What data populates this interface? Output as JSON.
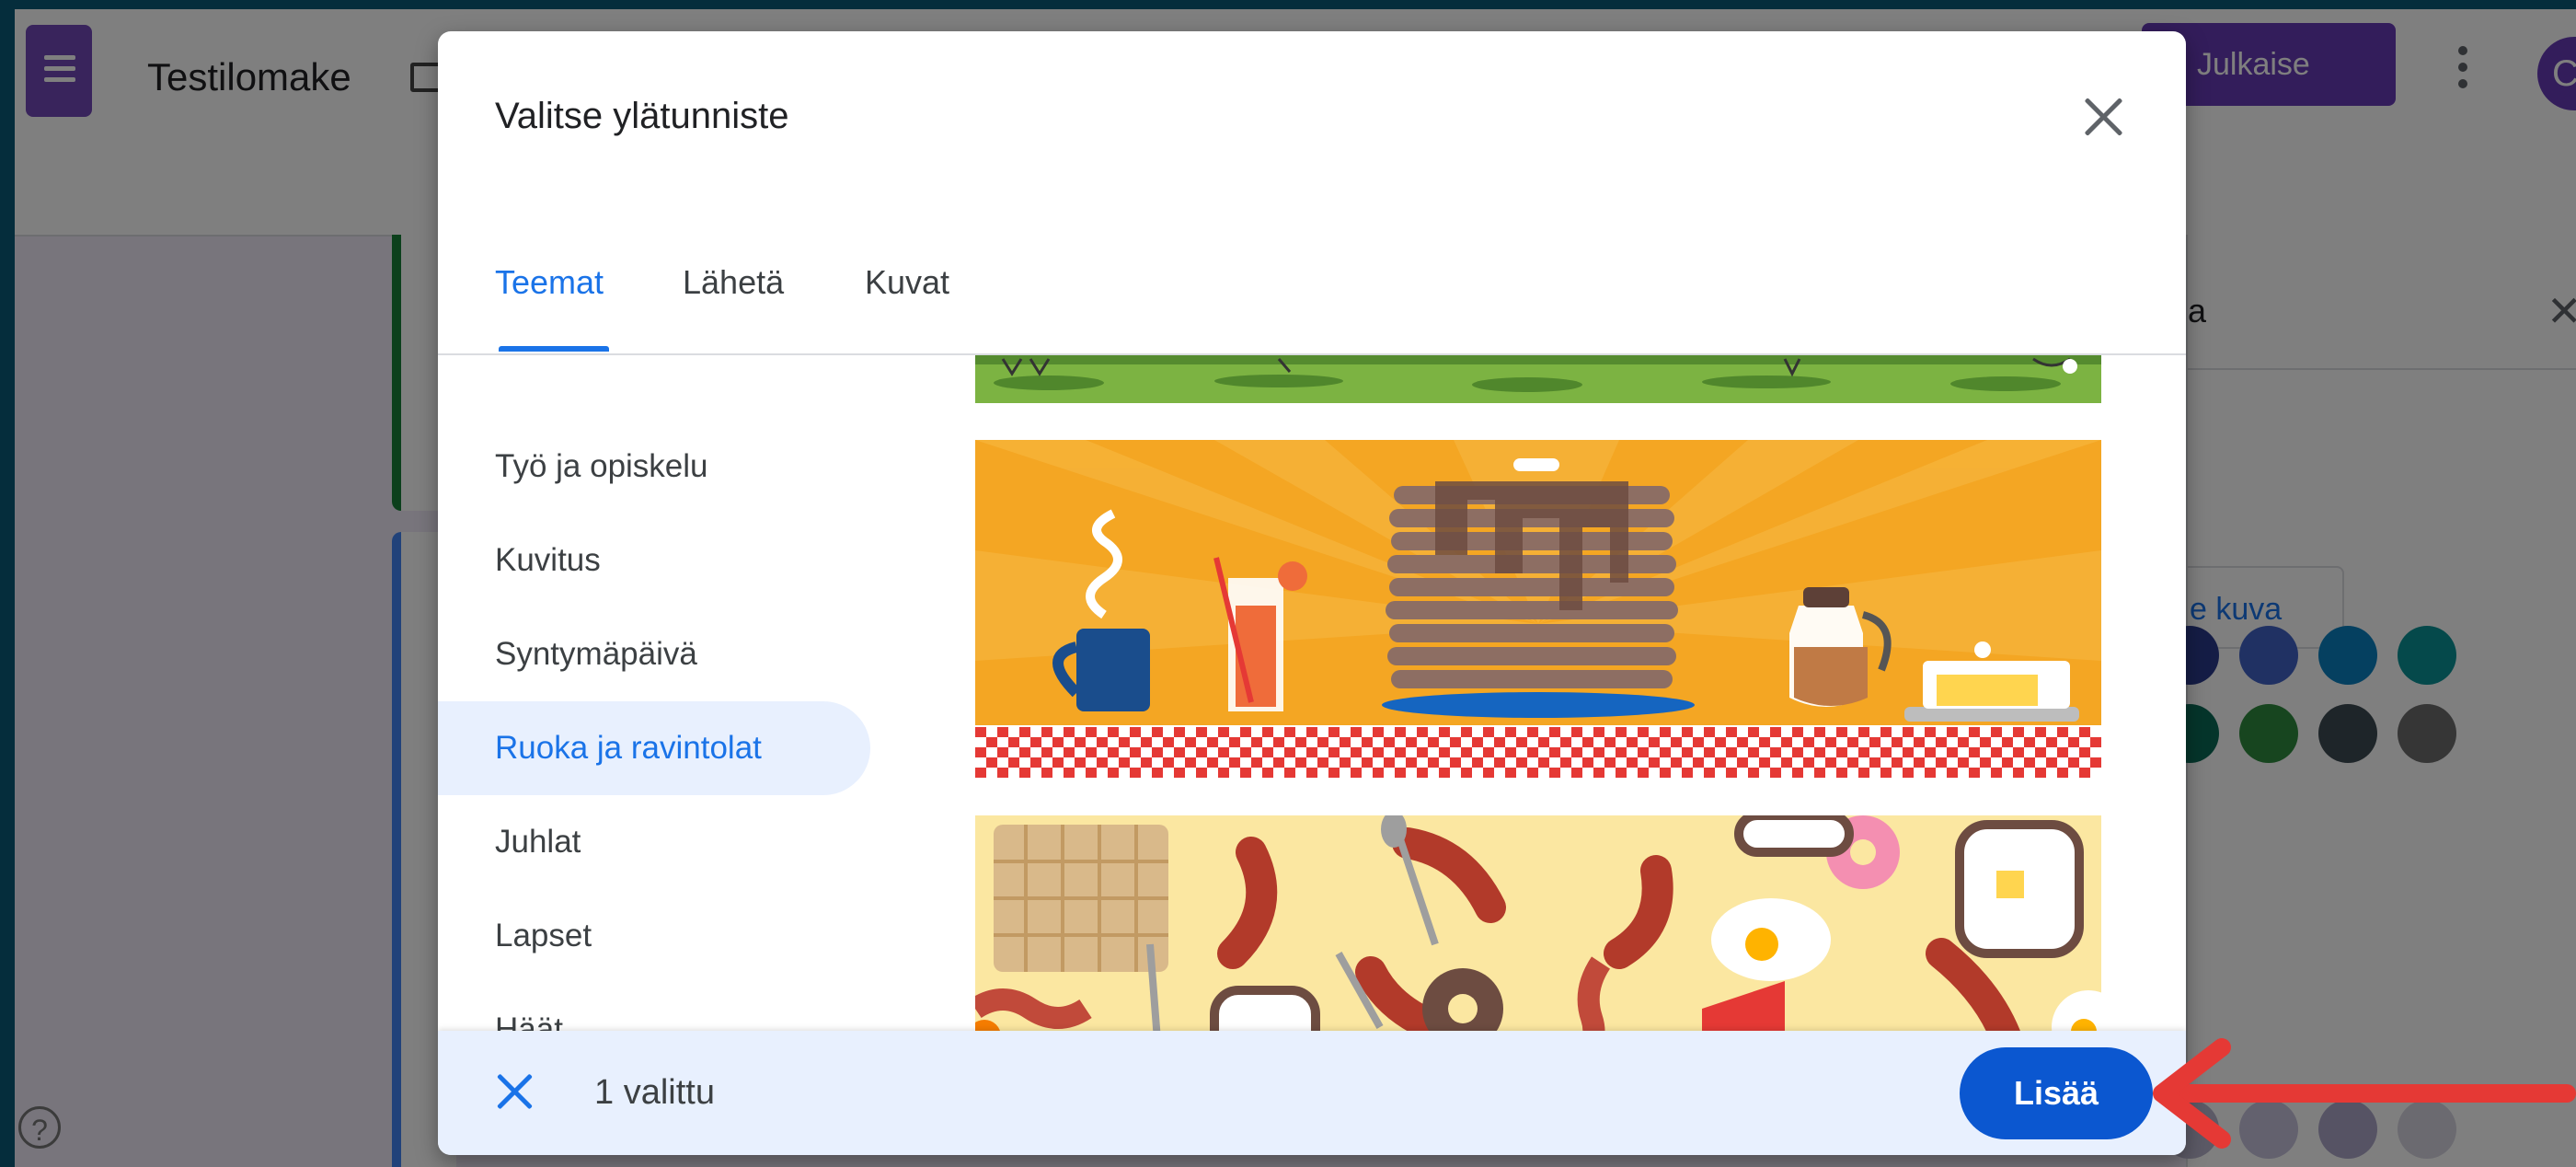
{
  "app": {
    "title": "Testilomake",
    "publish_label": "Julkaise",
    "avatar_letter": "C",
    "help_glyph": "?",
    "side_panel": {
      "header_fragment": "a",
      "image_button_fragment": "e kuva",
      "swatches_row1": [
        "#2b3a8c",
        "#4162c6",
        "#0b81c1",
        "#0a9396"
      ],
      "swatches_row2": [
        "#0b6b57",
        "#2e8b3e",
        "#3c4a52",
        "#6d6d6d"
      ],
      "swatches_row3": [
        "#b8b4cc",
        "#c6c2dc",
        "#aca6c8",
        "#d6d4e0"
      ]
    }
  },
  "dialog": {
    "title": "Valitse ylätunniste",
    "tabs": [
      {
        "label": "Teemat",
        "active": true
      },
      {
        "label": "Lähetä",
        "active": false
      },
      {
        "label": "Kuvat",
        "active": false
      }
    ],
    "categories": [
      {
        "label": "Työ ja opiskelu",
        "active": false
      },
      {
        "label": "Kuvitus",
        "active": false
      },
      {
        "label": "Syntymäpäivä",
        "active": false
      },
      {
        "label": "Ruoka ja ravintolat",
        "active": true
      },
      {
        "label": "Juhlat",
        "active": false
      },
      {
        "label": "Lapset",
        "active": false
      },
      {
        "label": "Häät",
        "active": false
      }
    ],
    "themes": [
      {
        "name": "grass-field-theme",
        "colors": [
          "#7cb342",
          "#558b2f"
        ]
      },
      {
        "name": "pancakes-breakfast-theme",
        "colors": [
          "#f4a623",
          "#e8a033",
          "#d32f2f"
        ]
      },
      {
        "name": "breakfast-pattern-theme",
        "colors": [
          "#fbe7a1",
          "#b23a2a"
        ]
      }
    ],
    "selection": {
      "count_label": "1 valittu",
      "add_label": "Lisää"
    }
  },
  "annotation": {
    "arrow_color": "#e53935"
  }
}
